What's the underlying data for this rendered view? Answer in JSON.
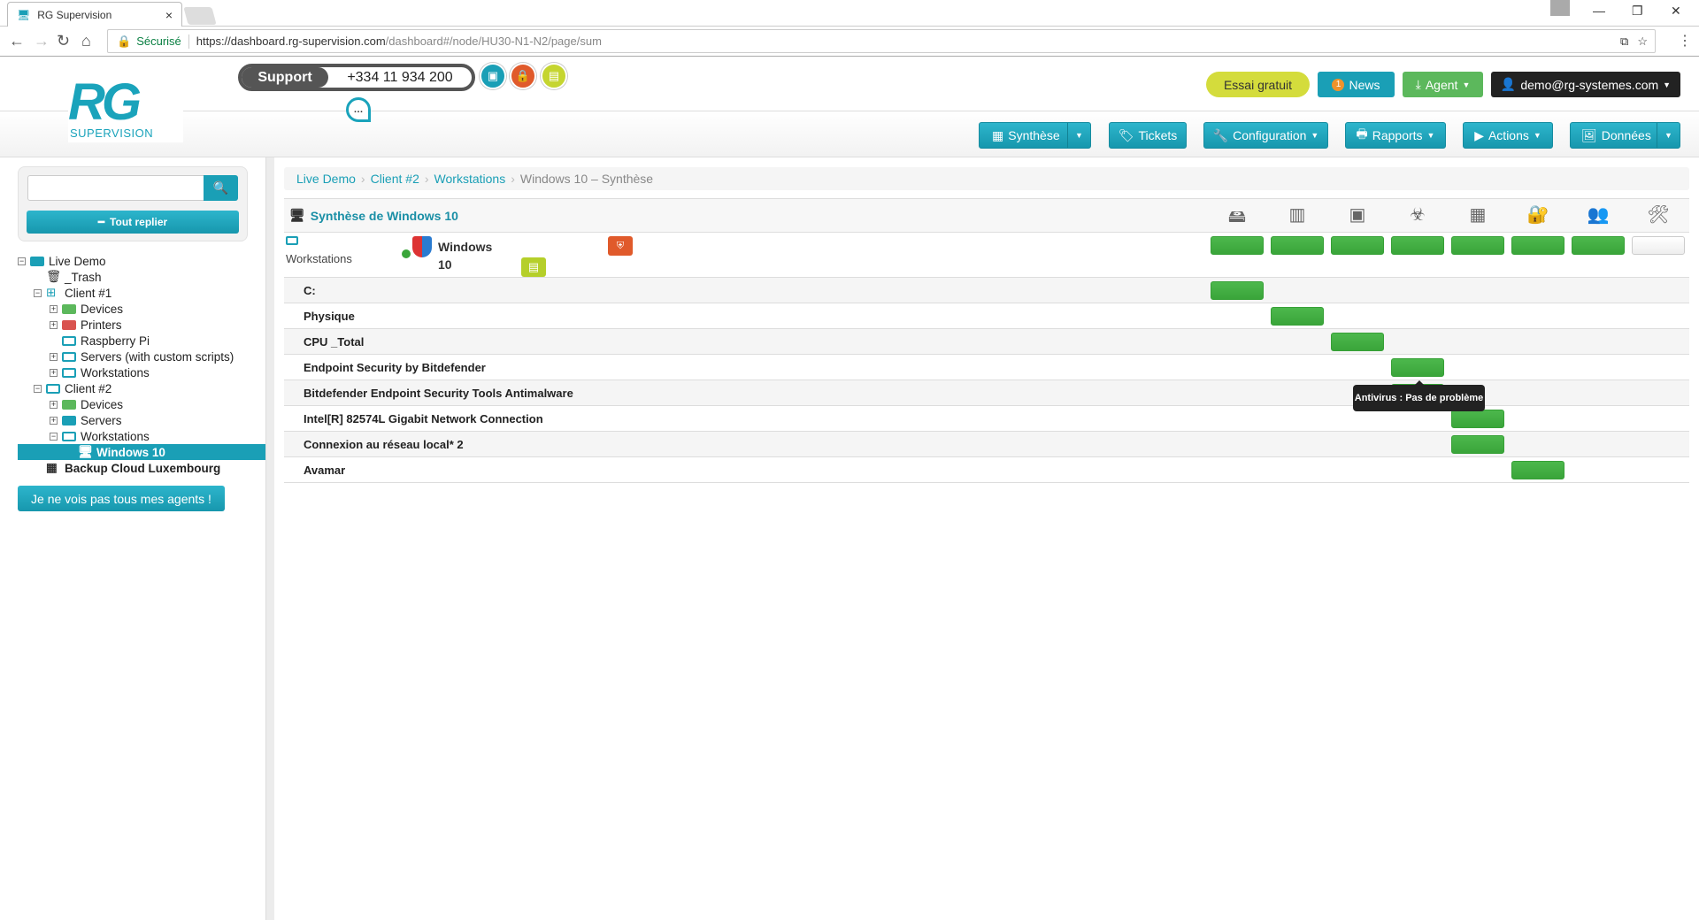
{
  "browser": {
    "tab_title": "RG Supervision",
    "secure_label": "Sécurisé",
    "url_host": "https://dashboard.rg-supervision.com",
    "url_path": "/dashboard#/node/HU30-N1-N2/page/sum"
  },
  "header": {
    "logo_text": "RG",
    "logo_sub": "SUPERVISION",
    "support_label": "Support",
    "support_phone": "+334 11 934 200",
    "chat_icon": "…",
    "trial": "Essai gratuit",
    "news": "News",
    "news_badge": "1",
    "agent": "Agent",
    "user": "demo@rg-systemes.com"
  },
  "colors": {
    "accent": "#1a9fb6",
    "ok": "#3aa53a",
    "trial": "#d4dc3c",
    "user_button": "#222222",
    "agent_button": "#5cb85c"
  },
  "nav": {
    "synthese": "Synthèse",
    "tickets": "Tickets",
    "configuration": "Configuration",
    "rapports": "Rapports",
    "actions": "Actions",
    "donnees": "Données"
  },
  "sidebar": {
    "search_placeholder": "",
    "collapse": "Tout replier",
    "agents_button": "Je ne vois pas tous mes agents !",
    "tree": [
      {
        "label": "Live Demo",
        "icon": "folder-blue",
        "level": 0,
        "toggle": "-"
      },
      {
        "label": "_Trash",
        "icon": "trash",
        "level": 1,
        "toggle": ""
      },
      {
        "label": "Client #1",
        "icon": "windows",
        "level": 1,
        "toggle": "-"
      },
      {
        "label": "Devices",
        "icon": "folder-green",
        "level": 2,
        "toggle": "+"
      },
      {
        "label": "Printers",
        "icon": "folder-red",
        "level": 2,
        "toggle": "+"
      },
      {
        "label": "Raspberry Pi",
        "icon": "folder-open",
        "level": 2,
        "toggle": ""
      },
      {
        "label": "Servers (with custom scripts)",
        "icon": "folder-open",
        "level": 2,
        "toggle": "+"
      },
      {
        "label": "Workstations",
        "icon": "folder-open",
        "level": 2,
        "toggle": "+"
      },
      {
        "label": "Client #2",
        "icon": "folder-open",
        "level": 1,
        "toggle": "-"
      },
      {
        "label": "Devices",
        "icon": "folder-green",
        "level": 2,
        "toggle": "+"
      },
      {
        "label": "Servers",
        "icon": "folder-blue",
        "level": 2,
        "toggle": "+"
      },
      {
        "label": "Workstations",
        "icon": "folder-open",
        "level": 2,
        "toggle": "-"
      },
      {
        "label": "Windows 10",
        "icon": "monitor",
        "level": 3,
        "toggle": "",
        "selected": true
      },
      {
        "label": "Backup Cloud Luxembourg",
        "icon": "grid",
        "level": 1,
        "toggle": "",
        "bold": true
      }
    ]
  },
  "breadcrumb": [
    "Live Demo",
    "Client #2",
    "Workstations"
  ],
  "breadcrumb_current": "Windows 10 – Synthèse",
  "main": {
    "title": "Synthèse de Windows 10",
    "columns": [
      "disk-icon",
      "memory-icon",
      "cpu-icon",
      "biohazard-icon",
      "network-icon",
      "security-lock-icon",
      "users-icon",
      "maintenance-icon"
    ],
    "node": {
      "group": "Workstations",
      "name_line1": "Windows",
      "name_line2": "10",
      "statuses": [
        "ok",
        "ok",
        "ok",
        "ok",
        "ok",
        "ok",
        "ok",
        "none"
      ]
    },
    "rows": [
      {
        "label": "C:",
        "col": 0
      },
      {
        "label": "Physique",
        "col": 1
      },
      {
        "label": "CPU _Total",
        "col": 2
      },
      {
        "label": "Endpoint Security by Bitdefender",
        "col": 3
      },
      {
        "label": "Bitdefender Endpoint Security Tools Antimalware",
        "col": 3
      },
      {
        "label": "Intel[R] 82574L Gigabit Network Connection",
        "col": 4
      },
      {
        "label": "Connexion au réseau local* 2",
        "col": 4
      },
      {
        "label": "Avamar",
        "col": 5
      }
    ],
    "tooltip": "Antivirus : Pas de problème"
  }
}
